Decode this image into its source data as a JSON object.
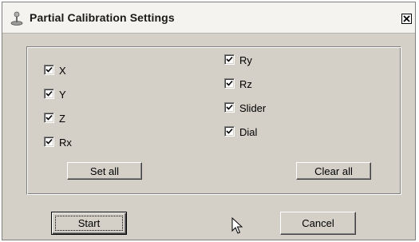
{
  "window": {
    "title": "Partial Calibration Settings",
    "title_icon": "joystick-icon",
    "close_icon": "close-icon"
  },
  "axes_left": [
    {
      "label": "X",
      "checked": true
    },
    {
      "label": "Y",
      "checked": true
    },
    {
      "label": "Z",
      "checked": true
    },
    {
      "label": "Rx",
      "checked": true
    }
  ],
  "axes_right": [
    {
      "label": "Ry",
      "checked": true
    },
    {
      "label": "Rz",
      "checked": true
    },
    {
      "label": "Slider",
      "checked": true
    },
    {
      "label": "Dial",
      "checked": true
    }
  ],
  "buttons": {
    "set_all": "Set all",
    "clear_all": "Clear all",
    "start": "Start",
    "cancel": "Cancel"
  },
  "colors": {
    "face": "#d4d0c8",
    "shadow": "#808080",
    "highlight": "#ffffff"
  },
  "cursor_icon": "arrow-cursor-icon"
}
